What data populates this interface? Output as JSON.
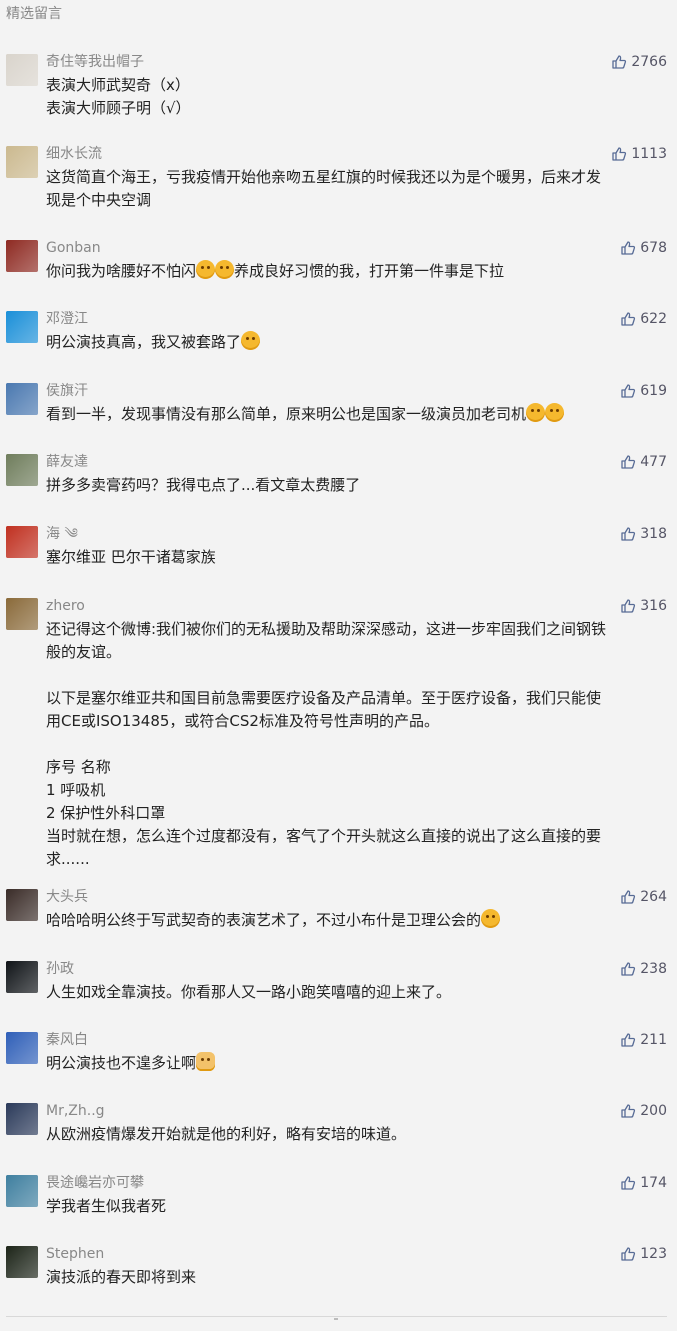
{
  "section_title": "精选留言",
  "comments": [
    {
      "nickname": "奇住等我出帽子",
      "likes": "2766",
      "lines": [
        "表演大师武契奇（x）",
        "表演大师顾子明（√）"
      ],
      "avatar_icon": "portrait-sketch-avatar",
      "avatar_color": "#d9d4cc"
    },
    {
      "nickname": "细水长流",
      "likes": "1113",
      "lines": [
        "这货简直个海王，亏我疫情开始他亲吻五星红旗的时候我还以为是个暖男，后来才发",
        "现是个中央空调"
      ],
      "avatar_icon": "flowers-avatar",
      "avatar_color": "#cbb98f"
    },
    {
      "nickname": "Gonban",
      "likes": "678",
      "lines": [
        "你问我为啥腰好不怕闪[emoji][emoji]养成良好习惯的我，打开第一件事是下拉"
      ],
      "avatar_icon": "red-gate-avatar",
      "avatar_color": "#8e2a22"
    },
    {
      "nickname": "邓澄江",
      "likes": "622",
      "lines": [
        "明公演技真高，我又被套路了[emoji]"
      ],
      "avatar_icon": "doraemon-avatar",
      "avatar_color": "#1a8fd8"
    },
    {
      "nickname": "侯旗汗",
      "likes": "619",
      "lines": [
        "看到一半，发现事情没有那么简单，原来明公也是国家一级演员加老司机[emoji][emoji]"
      ],
      "avatar_icon": "sea-sunset-avatar",
      "avatar_color": "#4a78b0"
    },
    {
      "nickname": "薛友達",
      "likes": "477",
      "lines": [
        "拼多多卖膏药吗？我得屯点了...看文章太费腰了"
      ],
      "avatar_icon": "person-photo-avatar",
      "avatar_color": "#6f7d5c"
    },
    {
      "nickname": "海 ༄",
      "likes": "318",
      "lines": [
        "塞尔维亚 巴尔干诸葛家族"
      ],
      "avatar_icon": "cartoon-hat-avatar",
      "avatar_color": "#c03020"
    },
    {
      "nickname": "zhero",
      "likes": "316",
      "lines": [
        "还记得这个微博:我们被你们的无私援助及帮助深深感动，这进一步牢固我们之间钢铁",
        "般的友谊。",
        "",
        "以下是塞尔维亚共和国目前急需要医疗设备及产品清单。至于医疗设备，我们只能使",
        "用CE或ISO13485，或符合CS2标准及符号性声明的产品。",
        "",
        "序号 名称",
        "1 呼吸机",
        "2 保护性外科口罩",
        "当时就在想，怎么连个过度都没有，客气了个开头就这么直接的说出了这么直接的要",
        "求......"
      ],
      "avatar_icon": "painting-avatar",
      "avatar_color": "#8a6a3a"
    },
    {
      "nickname": "大头兵",
      "likes": "264",
      "lines": [
        "哈哈哈明公终于写武契奇的表演艺术了，不过小布什是卫理公会的[emoji]"
      ],
      "avatar_icon": "face-photo-avatar",
      "avatar_color": "#3a2c28"
    },
    {
      "nickname": "孙政",
      "likes": "238",
      "lines": [
        "人生如戏全靠演技。你看那人又一路小跑笑嘻嘻的迎上来了。"
      ],
      "avatar_icon": "dark-sky-avatar",
      "avatar_color": "#101418"
    },
    {
      "nickname": "秦风白",
      "likes": "211",
      "lines": [
        "明公演技也不遑多让啊[emoji]"
      ],
      "avatar_icon": "figure-light-avatar",
      "avatar_color": "#2f5fb8"
    },
    {
      "nickname": "Mr,Zh..g",
      "likes": "200",
      "lines": [
        "从欧洲疫情爆发开始就是他的利好，略有安培的味道。"
      ],
      "avatar_icon": "crowd-avatar",
      "avatar_color": "#2b3a5a"
    },
    {
      "nickname": "畏途巉岩亦可攀",
      "likes": "174",
      "lines": [
        "学我者生似我者死"
      ],
      "avatar_icon": "wave-avatar",
      "avatar_color": "#3f7f9f"
    },
    {
      "nickname": "Stephen",
      "likes": "123",
      "lines": [
        "演技派的春天即将到来"
      ],
      "avatar_icon": "lamp-dark-avatar",
      "avatar_color": "#1c2418"
    }
  ]
}
